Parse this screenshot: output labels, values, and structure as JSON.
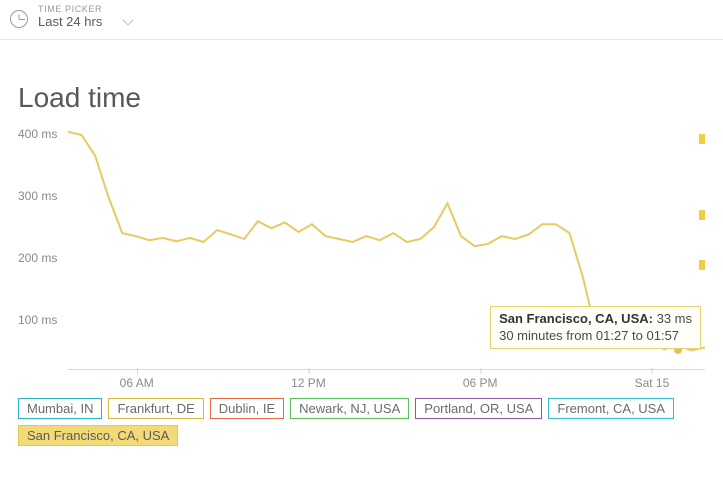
{
  "picker": {
    "label": "TIME PICKER",
    "value": "Last 24 hrs"
  },
  "chart_title": "Load time",
  "y_ticks": [
    "100 ms",
    "200 ms",
    "300 ms",
    "400 ms"
  ],
  "x_ticks": [
    "06 AM",
    "12 PM",
    "06 PM",
    "Sat 15"
  ],
  "tooltip": {
    "line1_label": "San Francisco, CA, USA:",
    "line1_value": "33 ms",
    "line2": "30 minutes from 01:27 to 01:57"
  },
  "legend": [
    {
      "label": "Mumbai, IN",
      "color": "#2fb4c6",
      "active": false
    },
    {
      "label": "Frankfurt, DE",
      "color": "#d9b94a",
      "active": false
    },
    {
      "label": "Dublin, IE",
      "color": "#e86a3f",
      "active": false
    },
    {
      "label": "Newark, NJ, USA",
      "color": "#5bc15b",
      "active": false
    },
    {
      "label": "Portland, OR, USA",
      "color": "#8a5aa8",
      "active": false
    },
    {
      "label": "Fremont, CA, USA",
      "color": "#3fb9cf",
      "active": false
    },
    {
      "label": "San Francisco, CA, USA",
      "color": "#e4c851",
      "active": true
    }
  ],
  "chart_data": {
    "type": "line",
    "title": "Load time",
    "xlabel": "",
    "ylabel": "ms",
    "ylim": [
      0,
      420
    ],
    "x_range_label": "Last 24 hrs",
    "x_tick_labels": [
      "06 AM",
      "12 PM",
      "06 PM",
      "Sat 15"
    ],
    "series": [
      {
        "name": "San Francisco, CA, USA",
        "color": "#e8ca63",
        "x_hours": [
          0,
          0.5,
          1,
          1.5,
          2,
          2.5,
          3,
          3.5,
          4,
          4.5,
          5,
          5.5,
          6,
          6.5,
          7,
          7.5,
          8,
          8.5,
          9,
          9.5,
          10,
          10.5,
          11,
          11.5,
          12,
          12.5,
          13,
          13.5,
          14,
          14.5,
          15,
          15.5,
          16,
          16.5,
          17,
          17.5,
          18,
          18.5,
          19,
          19.5,
          20,
          20.5,
          21,
          21.5,
          22,
          22.5,
          23,
          23.5
        ],
        "y_ms": [
          400,
          395,
          360,
          290,
          230,
          225,
          218,
          222,
          216,
          222,
          215,
          235,
          228,
          220,
          250,
          238,
          248,
          232,
          245,
          225,
          220,
          215,
          225,
          218,
          230,
          215,
          220,
          240,
          280,
          225,
          208,
          212,
          225,
          220,
          228,
          245,
          245,
          230,
          155,
          60,
          55,
          48,
          40,
          45,
          35,
          42,
          33,
          38
        ]
      }
    ],
    "highlight_point": {
      "series": "San Francisco, CA, USA",
      "x_hour": 22.5,
      "y_ms": 33,
      "label": "30 minutes from 01:27 to 01:57"
    }
  }
}
